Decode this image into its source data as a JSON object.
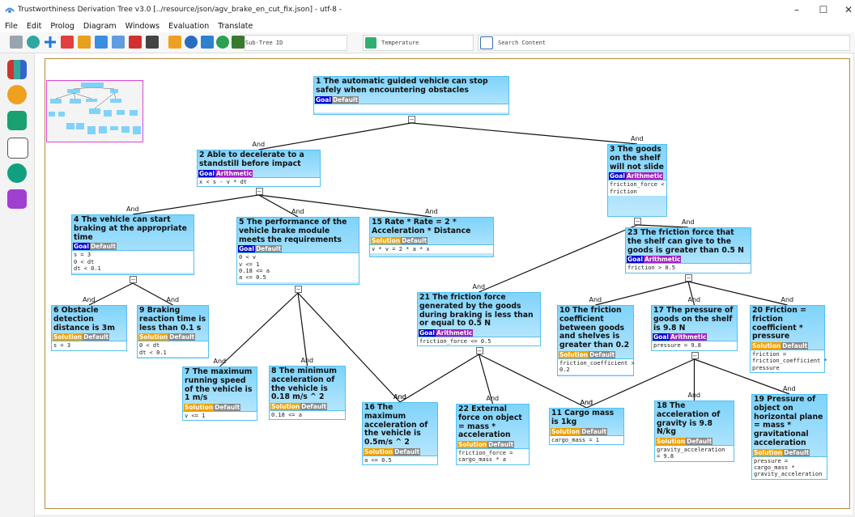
{
  "window": {
    "title": "Trustworthiness Derivation Tree v3.0 [../resource/json/agv_brake_en_cut_fix.json] - utf-8 -",
    "controls": [
      "–",
      "☐",
      "✕"
    ]
  },
  "menu": [
    "File",
    "Edit",
    "Prolog",
    "Diagram",
    "Windows",
    "Evaluation",
    "Translate"
  ],
  "toolbar": {
    "subtree_label": "Sub-Tree ID",
    "temperature_label": "Temperature",
    "search_label": "Search Content",
    "icons": [
      "save-icon",
      "refresh-icon",
      "add-icon",
      "delete-icon",
      "edit-icon",
      "tree-icon",
      "table-icon",
      "cut-icon",
      "export-icon",
      "grid-icon",
      "settings-icon",
      "browser-icon",
      "fx-icon",
      "gear-icon"
    ]
  },
  "sidebar": {
    "icons": [
      "books-icon",
      "document-icon",
      "chip-icon",
      "analysis-icon",
      "hierarchy-icon",
      "openai-icon"
    ]
  },
  "edge_label": "And",
  "collapse_symbol": "–",
  "colors": {
    "goal": "#0000cc",
    "solution": "#f0a000",
    "default": "#888888",
    "arithmetic": "#a020c0",
    "node_border": "#55c0ee"
  },
  "nodes": [
    {
      "id": "n1",
      "title": "1 The automatic guided vehicle can stop safely when encountering obstacles",
      "type": "Goal",
      "method": "Default",
      "formula": ""
    },
    {
      "id": "n2",
      "title": "2 Able to decelerate to a standstill before impact",
      "type": "Goal",
      "method": "Arithmetic",
      "formula": "x < s - v * dt"
    },
    {
      "id": "n3",
      "title": "3 The goods on the shelf will not slide",
      "type": "Goal",
      "method": "Arithmetic",
      "formula": "friction_force <\nfriction"
    },
    {
      "id": "n4",
      "title": "4 The vehicle can start braking at the appropriate time",
      "type": "Goal",
      "method": "Default",
      "formula": "s = 3\n0 < dt\ndt < 0.1"
    },
    {
      "id": "n5",
      "title": "5 The performance of the vehicle brake module meets the requirements",
      "type": "Goal",
      "method": "Default",
      "formula": "0 < v\nv <= 1\n0.18 <= a\na <= 0.5"
    },
    {
      "id": "n15",
      "title": "15 Rate * Rate = 2 * Acceleration * Distance",
      "type": "Solution",
      "method": "Default",
      "formula": "v * v = 2 * a * x"
    },
    {
      "id": "n23",
      "title": "23 The friction force that the shelf can give to the goods is greater than 0.5 N",
      "type": "Goal",
      "method": "Arithmetic",
      "formula": "friction > 0.5"
    },
    {
      "id": "n6",
      "title": "6 Obstacle detection distance is 3m",
      "type": "Solution",
      "method": "Default",
      "formula": "s = 3"
    },
    {
      "id": "n9",
      "title": "9 Braking reaction time is less than 0.1 s",
      "type": "Solution",
      "method": "Default",
      "formula": "0 < dt\ndt < 0.1"
    },
    {
      "id": "n21",
      "title": "21 The friction force generated by the goods during braking is less than or equal to 0.5 N",
      "type": "Goal",
      "method": "Arithmetic",
      "formula": "friction_force <= 0.5"
    },
    {
      "id": "n10",
      "title": "10 The friction coefficient between goods and shelves is greater than 0.2",
      "type": "Solution",
      "method": "Default",
      "formula": "friction_coefficient >\n0.2"
    },
    {
      "id": "n17",
      "title": "17 The pressure of goods on the shelf is 9.8 N",
      "type": "Goal",
      "method": "Arithmetic",
      "formula": "pressure = 9.8"
    },
    {
      "id": "n20",
      "title": "20 Friction = friction coefficient * pressure",
      "type": "Solution",
      "method": "Default",
      "formula": "friction =\nfriction_coefficient *\npressure"
    },
    {
      "id": "n7",
      "title": "7 The maximum running speed of the vehicle is 1 m/s",
      "type": "Solution",
      "method": "Default",
      "formula": "v <= 1"
    },
    {
      "id": "n8",
      "title": "8 The minimum acceleration of the vehicle is 0.18 m/s ^ 2",
      "type": "Solution",
      "method": "Default",
      "formula": "0.18 <= a"
    },
    {
      "id": "n16",
      "title": "16 The maximum acceleration of the vehicle is 0.5m/s ^ 2",
      "type": "Solution",
      "method": "Default",
      "formula": "a <= 0.5"
    },
    {
      "id": "n22",
      "title": "22 External force on object = mass * acceleration",
      "type": "Solution",
      "method": "Default",
      "formula": "friction_force =\ncargo_mass * a"
    },
    {
      "id": "n11",
      "title": "11 Cargo mass is 1kg",
      "type": "Solution",
      "method": "Default",
      "formula": "cargo_mass = 1"
    },
    {
      "id": "n18",
      "title": "18 The acceleration of gravity is 9.8 N/kg",
      "type": "Solution",
      "method": "Default",
      "formula": "gravity_acceleration\n= 9.8"
    },
    {
      "id": "n19",
      "title": "19 Pressure of object on horizontal plane = mass * gravitational acceleration",
      "type": "Solution",
      "method": "Default",
      "formula": "pressure =\ncargo_mass *\ngravity_acceleration"
    }
  ],
  "edges": [
    [
      "n1",
      "n2"
    ],
    [
      "n1",
      "n3"
    ],
    [
      "n2",
      "n4"
    ],
    [
      "n2",
      "n5"
    ],
    [
      "n2",
      "n15"
    ],
    [
      "n3",
      "n23"
    ],
    [
      "n3",
      "n21"
    ],
    [
      "n4",
      "n6"
    ],
    [
      "n4",
      "n9"
    ],
    [
      "n5",
      "n7"
    ],
    [
      "n5",
      "n8"
    ],
    [
      "n5",
      "n16"
    ],
    [
      "n23",
      "n10"
    ],
    [
      "n23",
      "n17"
    ],
    [
      "n23",
      "n20"
    ],
    [
      "n21",
      "n16"
    ],
    [
      "n21",
      "n22"
    ],
    [
      "n21",
      "n11"
    ],
    [
      "n17",
      "n11"
    ],
    [
      "n17",
      "n18"
    ],
    [
      "n17",
      "n19"
    ]
  ]
}
